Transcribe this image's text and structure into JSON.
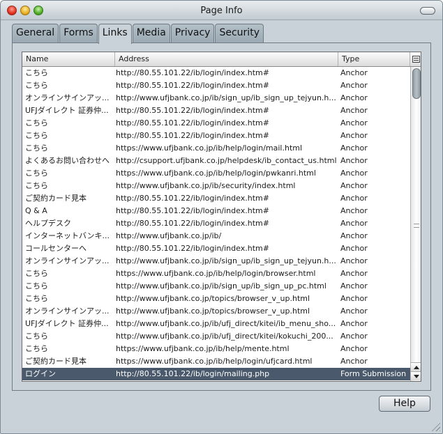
{
  "window": {
    "title": "Page Info"
  },
  "tabs": [
    {
      "label": "General"
    },
    {
      "label": "Forms"
    },
    {
      "label": "Links",
      "active": true
    },
    {
      "label": "Media"
    },
    {
      "label": "Privacy"
    },
    {
      "label": "Security"
    }
  ],
  "table": {
    "columns": {
      "name": "Name",
      "address": "Address",
      "type": "Type"
    },
    "rows": [
      {
        "name": "こちら",
        "address": "http://80.55.101.22/ib/login/index.htm#",
        "type": "Anchor"
      },
      {
        "name": "こちら",
        "address": "http://80.55.101.22/ib/login/index.htm#",
        "type": "Anchor"
      },
      {
        "name": "オンラインサインアッ...",
        "address": "http://www.ufjbank.co.jp/ib/sign_up/ib_sign_up_tejyun.h...",
        "type": "Anchor"
      },
      {
        "name": "UFJダイレクト 証券仲...",
        "address": "http://80.55.101.22/ib/login/index.htm#",
        "type": "Anchor"
      },
      {
        "name": "こちら",
        "address": "http://80.55.101.22/ib/login/index.htm#",
        "type": "Anchor"
      },
      {
        "name": "こちら",
        "address": "http://80.55.101.22/ib/login/index.htm#",
        "type": "Anchor"
      },
      {
        "name": "こちら",
        "address": "https://www.ufjbank.co.jp/ib/help/login/mail.html",
        "type": "Anchor"
      },
      {
        "name": "よくあるお問い合わせへ",
        "address": "http://csupport.ufjbank.co.jp/helpdesk/ib_contact_us.html",
        "type": "Anchor"
      },
      {
        "name": "こちら",
        "address": "https://www.ufjbank.co.jp/ib/help/login/pwkanri.html",
        "type": "Anchor"
      },
      {
        "name": "こちら",
        "address": "http://www.ufjbank.co.jp/ib/security/index.html",
        "type": "Anchor"
      },
      {
        "name": "ご契約カード見本",
        "address": "http://80.55.101.22/ib/login/index.htm#",
        "type": "Anchor"
      },
      {
        "name": "Q & A",
        "address": "http://80.55.101.22/ib/login/index.htm#",
        "type": "Anchor"
      },
      {
        "name": "ヘルプデスク",
        "address": "http://80.55.101.22/ib/login/index.htm#",
        "type": "Anchor"
      },
      {
        "name": "インターネットバンキ...",
        "address": "http://www.ufjbank.co.jp/ib/",
        "type": "Anchor"
      },
      {
        "name": "コールセンターへ",
        "address": "http://80.55.101.22/ib/login/index.htm#",
        "type": "Anchor"
      },
      {
        "name": "オンラインサインアッ...",
        "address": "http://www.ufjbank.co.jp/ib/sign_up/ib_sign_up_tejyun.h...",
        "type": "Anchor"
      },
      {
        "name": "こちら",
        "address": "https://www.ufjbank.co.jp/ib/help/login/browser.html",
        "type": "Anchor"
      },
      {
        "name": "こちら",
        "address": "http://www.ufjbank.co.jp/ib/sign_up/ib_sign_up_pc.html",
        "type": "Anchor"
      },
      {
        "name": "こちら",
        "address": "http://www.ufjbank.co.jp/topics/browser_v_up.html",
        "type": "Anchor"
      },
      {
        "name": "オンラインサインアッ...",
        "address": "http://www.ufjbank.co.jp/topics/browser_v_up.html",
        "type": "Anchor"
      },
      {
        "name": "UFJダイレクト 証券仲...",
        "address": "http://www.ufjbank.co.jp/ib/ufj_direct/kitei/ib_menu_sho...",
        "type": "Anchor"
      },
      {
        "name": "こちら",
        "address": "http://www.ufjbank.co.jp/ib/ufj_direct/kitei/kokuchi_200...",
        "type": "Anchor"
      },
      {
        "name": "こちら",
        "address": "https://www.ufjbank.co.jp/ib/help/mente.html",
        "type": "Anchor"
      },
      {
        "name": "ご契約カード見本",
        "address": "https://www.ufjbank.co.jp/ib/help/login/ufjcard.html",
        "type": "Anchor"
      },
      {
        "name": "ログイン",
        "address": "http://80.55.101.22/ib/login/mailing.php",
        "type": "Form Submission",
        "selected": true
      }
    ]
  },
  "footer": {
    "help_label": "Help"
  },
  "colors": {
    "window_bg": "#c9d2d8",
    "selection": "#4a5a6c"
  }
}
